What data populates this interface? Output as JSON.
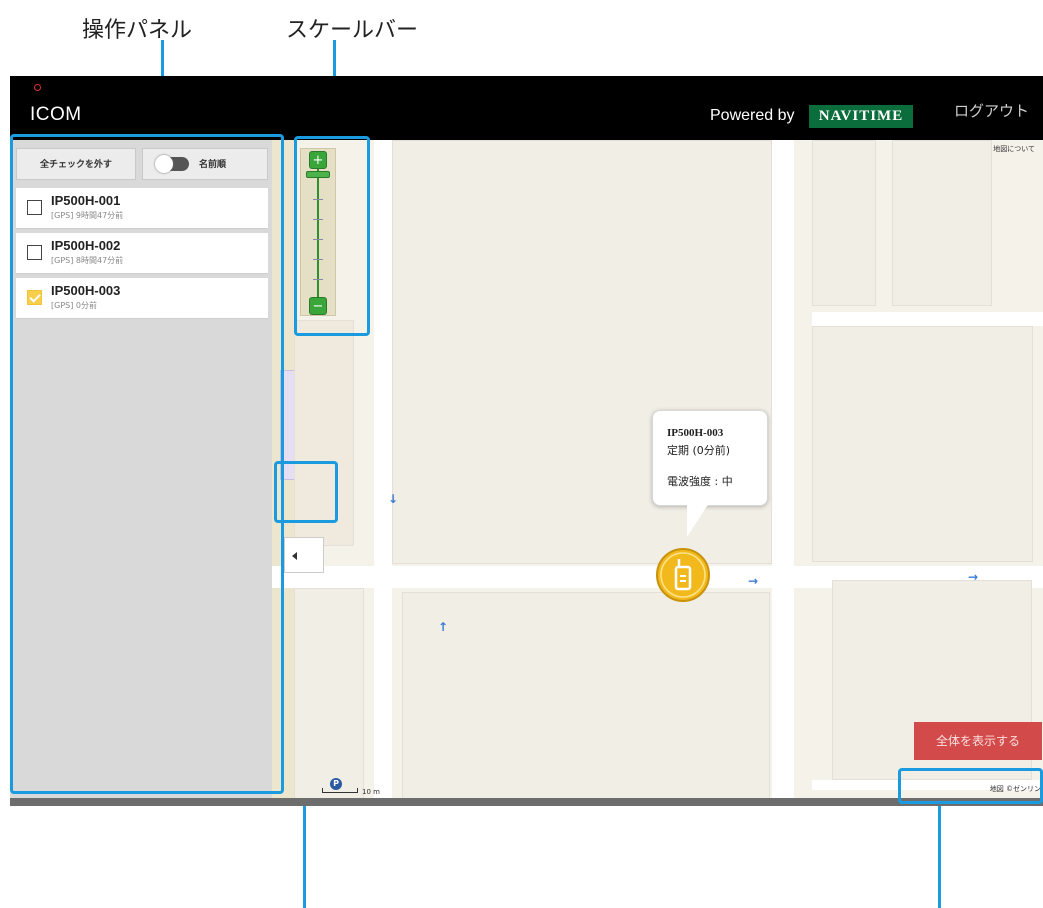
{
  "callouts": {
    "operation_panel": "操作パネル",
    "scale_bar": "スケールバー"
  },
  "header": {
    "logo": "ICOM",
    "powered_by": "Powered by",
    "navitime": "NAVITIME",
    "logout": "ログアウト"
  },
  "panel": {
    "uncheck_all": "全チェックを外す",
    "names_label": "名前順",
    "devices": [
      {
        "name": "IP500H-001",
        "sub": "[GPS] 9時間47分前",
        "checked": false
      },
      {
        "name": "IP500H-002",
        "sub": "[GPS] 8時間47分前",
        "checked": false
      },
      {
        "name": "IP500H-003",
        "sub": "[GPS] 0分前",
        "checked": true
      }
    ]
  },
  "map": {
    "about_map": "地図について",
    "popup": {
      "device": "IP500H-003",
      "status": "定期 (0分前)",
      "signal": "電波強度 : 中"
    },
    "show_all": "全体を表示する",
    "scale": "10 m",
    "credit": "地図 ©ゼンリン",
    "parking": "P",
    "zoom_in": "+",
    "zoom_out": "−"
  },
  "colors": {
    "highlight": "#1a9be0",
    "navitime": "#0b6d3b",
    "show_all": "#d24a4a",
    "marker": "#f2b91c"
  }
}
